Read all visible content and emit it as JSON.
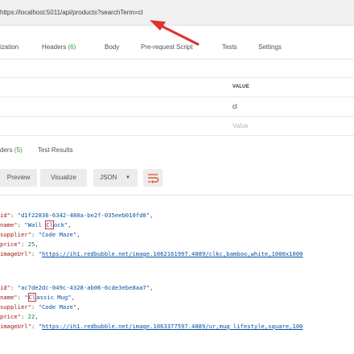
{
  "url_bar": {
    "url": "https://localhost:5011/api/products?searchTerm=cl"
  },
  "request_tabs": [
    {
      "label": "ization"
    },
    {
      "label": "Headers",
      "count": "(6)"
    },
    {
      "label": "Body"
    },
    {
      "label": "Pre-request Script"
    },
    {
      "label": "Tests"
    },
    {
      "label": "Settings"
    }
  ],
  "params": {
    "value_header": "VALUE",
    "value": "cl",
    "value_placeholder": "Value"
  },
  "response_tabs": [
    {
      "label": "ders",
      "count": "(5)"
    },
    {
      "label": "Test Results"
    }
  ],
  "view_buttons": {
    "preview": "Preview",
    "visualize": "Visualize",
    "format": "JSON"
  },
  "response": {
    "items": [
      {
        "id": "d1f22836-6342-480a-be2f-035eeb010fd0",
        "name_hl": "Cl",
        "name_pre": "Wall ",
        "name_post": "ock",
        "supplier": "Code Maze",
        "price": "25",
        "imageUrl": "https://ih1.redbubble.net/image.1062161997.4889/clkc,bamboo,white,1000x1000"
      },
      {
        "id": "ac7de2dc-049c-4328-ab06-6cde3ebe8aa7",
        "name_hl": "Cl",
        "name_pre": "",
        "name_post": "assic Mug",
        "supplier": "Code Maze",
        "price": "22",
        "imageUrl": "https://ih1.redbubble.net/image.1063377597.4889/ur,mug_lifestyle,square,100"
      }
    ]
  },
  "colors": {
    "accent": "#e03030",
    "count_green": "#2e9b3b"
  }
}
